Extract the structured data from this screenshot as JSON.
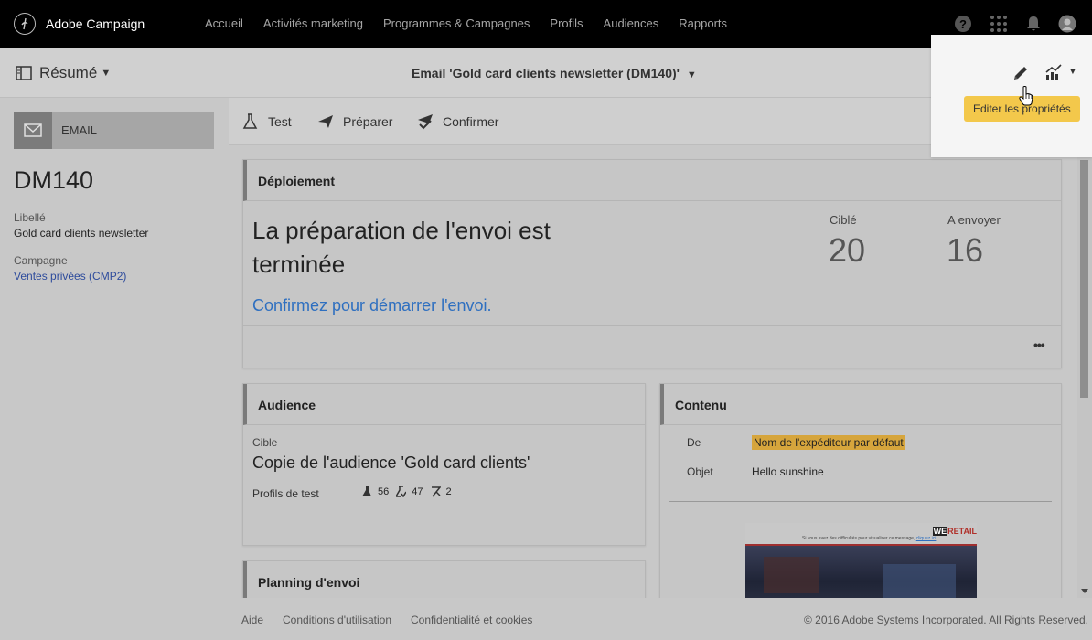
{
  "topbar": {
    "brand": "Adobe Campaign",
    "nav": [
      "Accueil",
      "Activités marketing",
      "Programmes & Campagnes",
      "Profils",
      "Audiences",
      "Rapports"
    ],
    "icons": [
      "help-icon",
      "apps-grid-icon",
      "bell-icon",
      "user-avatar-icon"
    ]
  },
  "header": {
    "resume_label": "Résumé",
    "title": "Email 'Gold card clients newsletter (DM140)'"
  },
  "overlay": {
    "tooltip": "Editer les propriétés"
  },
  "left": {
    "tile_label": "EMAIL",
    "code": "DM140",
    "libelle_label": "Libellé",
    "libelle_value": "Gold card clients newsletter",
    "campagne_label": "Campagne",
    "campagne_value": "Ventes privées (CMP2)"
  },
  "toolbar": {
    "test": "Test",
    "preparer": "Préparer",
    "confirmer": "Confirmer"
  },
  "deploiement": {
    "heading": "Déploiement",
    "message_line1": "La préparation de l'envoi est",
    "message_line2": "terminée",
    "link": "Confirmez pour démarrer l'envoi.",
    "cible_label": "Ciblé",
    "cible_value": "20",
    "envoyer_label": "A envoyer",
    "envoyer_value": "16",
    "more": "•••"
  },
  "audience": {
    "heading": "Audience",
    "cible_label": "Cible",
    "cible_value": "Copie de l'audience 'Gold card clients'",
    "profils_label": "Profils de test",
    "count1": "56",
    "count2": "47",
    "count3": "2"
  },
  "planning": {
    "heading": "Planning d'envoi"
  },
  "contenu": {
    "heading": "Contenu",
    "de_label": "De",
    "de_value": "Nom de l'expéditeur par défaut",
    "objet_label": "Objet",
    "objet_value": "Hello sunshine",
    "preview_text": "Si vous avez des difficultés pour visualiser ce message,",
    "preview_link": "cliquez ici",
    "preview_brand_a": "WE",
    "preview_brand_b": "RETAIL"
  },
  "footer": {
    "aide": "Aide",
    "conditions": "Conditions d'utilisation",
    "confidentialite": "Confidentialité et cookies",
    "copyright": "© 2016 Adobe Systems Incorporated. All Rights Reserved."
  },
  "colors": {
    "accent_blue": "#2e6fc0",
    "tooltip_yellow": "#f3c84b",
    "topbar": "#000000"
  }
}
